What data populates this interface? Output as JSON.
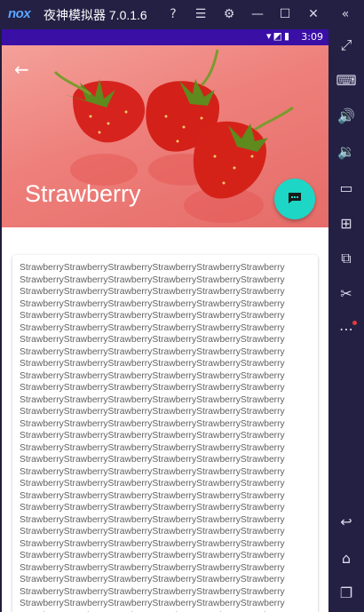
{
  "window": {
    "logo": "nox",
    "title": "夜神模拟器 7.0.1.6",
    "icons": [
      "help-icon",
      "menu-icon",
      "gear-icon",
      "minimize-icon",
      "maximize-icon",
      "close-icon",
      "collapse-icon"
    ]
  },
  "status": {
    "time": "3:09"
  },
  "app": {
    "title": "Strawberry",
    "content": "StrawberryStrawberryStrawberryStrawberryStrawberryStrawberry\nStrawberryStrawberryStrawberryStrawberryStrawberryStrawberry\nStrawberryStrawberryStrawberryStrawberryStrawberryStrawberry\nStrawberryStrawberryStrawberryStrawberryStrawberryStrawberry\nStrawberryStrawberryStrawberryStrawberryStrawberryStrawberry\nStrawberryStrawberryStrawberryStrawberryStrawberryStrawberry\nStrawberryStrawberryStrawberryStrawberryStrawberryStrawberry\nStrawberryStrawberryStrawberryStrawberryStrawberryStrawberry\nStrawberryStrawberryStrawberryStrawberryStrawberryStrawberry\nStrawberryStrawberryStrawberryStrawberryStrawberryStrawberry\nStrawberryStrawberryStrawberryStrawberryStrawberryStrawberry\nStrawberryStrawberryStrawberryStrawberryStrawberryStrawberry\nStrawberryStrawberryStrawberryStrawberryStrawberryStrawberry\nStrawberryStrawberryStrawberryStrawberryStrawberryStrawberry\nStrawberryStrawberryStrawberryStrawberryStrawberryStrawberry\nStrawberryStrawberryStrawberryStrawberryStrawberryStrawberry\nStrawberryStrawberryStrawberryStrawberryStrawberryStrawberry\nStrawberryStrawberryStrawberryStrawberryStrawberryStrawberry\nStrawberryStrawberryStrawberryStrawberryStrawberryStrawberry\nStrawberryStrawberryStrawberryStrawberryStrawberryStrawberry\nStrawberryStrawberryStrawberryStrawberryStrawberryStrawberry\nStrawberryStrawberryStrawberryStrawberryStrawberryStrawberry\nStrawberryStrawberryStrawberryStrawberryStrawberryStrawberry\nStrawberryStrawberryStrawberryStrawberryStrawberryStrawberry\nStrawberryStrawberryStrawberryStrawberryStrawberryStrawberry\nStrawberryStrawberryStrawberryStrawberryStrawberryStrawberry\nStrawberryStrawberryStrawberryStrawberryStrawberryStrawberry\nStrawberryStrawberryStrawberryStrawberryStrawberryStrawberry\nStrawberryStrawberryStrawberryStrawberryStrawberryStrawberry\nStrawberryStrawberryStrawberryStrawberryStrawberryStrawberry\nStrawberryStrawberryStrawberryStrawberryStrawberryStrawberry",
    "fab_icon": "chat-icon",
    "accent_color": "#1dd6c6",
    "statusbar_color": "#3a0fa6"
  },
  "sidebar": {
    "icons": [
      "fullscreen-icon",
      "keyboard-icon",
      "volume-up-icon",
      "volume-down-icon",
      "screen-icon",
      "apk-install-icon",
      "multi-instance-icon",
      "scissors-icon",
      "more-icon",
      "back-icon",
      "home-icon",
      "recent-apps-icon"
    ]
  }
}
